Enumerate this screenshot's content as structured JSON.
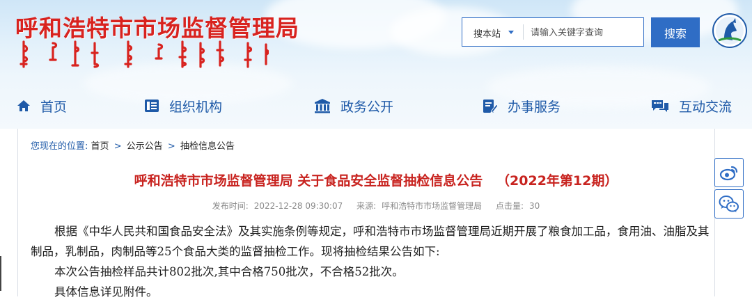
{
  "site": {
    "title": "呼和浩特市市场监督管理局",
    "mongolian_title": "ᠬᠥᠬᠡᠬᠣᠲᠠ ᠶᠢᠨ ᠵᠠᠬᠠ ᠵᠡᠭᠡᠯᠢ ᠶᠢᠨ ᠬᠢᠨᠠᠨ ᠬᠠᠷᠭᠤᠯᠬᠤ ᠲᠣᠪᠴᠢᠶ᠎ᠠ"
  },
  "search": {
    "scope_label": "搜本站",
    "placeholder": "请输入关键字查询",
    "value": "",
    "button_label": "搜索"
  },
  "nav": {
    "items": [
      {
        "label": "首页",
        "icon": "home-icon"
      },
      {
        "label": "组织机构",
        "icon": "org-structure-icon"
      },
      {
        "label": "政务公开",
        "icon": "government-building-icon"
      },
      {
        "label": "办事服务",
        "icon": "service-edit-icon"
      },
      {
        "label": "互动交流",
        "icon": "chat-bubbles-icon"
      }
    ]
  },
  "breadcrumb": {
    "label": "您现在的位置:",
    "items": [
      "首页",
      "公示公告",
      "抽检信息公告"
    ],
    "separator": ">"
  },
  "article": {
    "title": "呼和浩特市市场监督管理局 关于食品安全监督抽检信息公告   （2022年第12期）",
    "publish_time_label": "发布时间:",
    "publish_time": "2022-12-28 09:30:07",
    "source_label": "来源:",
    "source": "呼和浩特市市场监督管理局",
    "clicks_label": "点击量:",
    "clicks": "30",
    "paragraphs": [
      "根据《中华人民共和国食品安全法》及其实施条例等规定，呼和浩特市市场监督管理局近期开展了粮食加工品，食用油、油脂及其制品，乳制品，肉制品等25个食品大类的监督抽检工作。现将抽检结果公告如下:",
      "本次公告抽检样品共计802批次,其中合格750批次，不合格52批次。",
      "具体信息详见附件。"
    ]
  },
  "share": {
    "weibo_icon": "weibo-icon",
    "wechat_icon": "wechat-icon"
  },
  "colors": {
    "brand_blue": "#2f6dc5",
    "title_red": "#d8231f",
    "nav_blue": "#1f5aa8"
  }
}
